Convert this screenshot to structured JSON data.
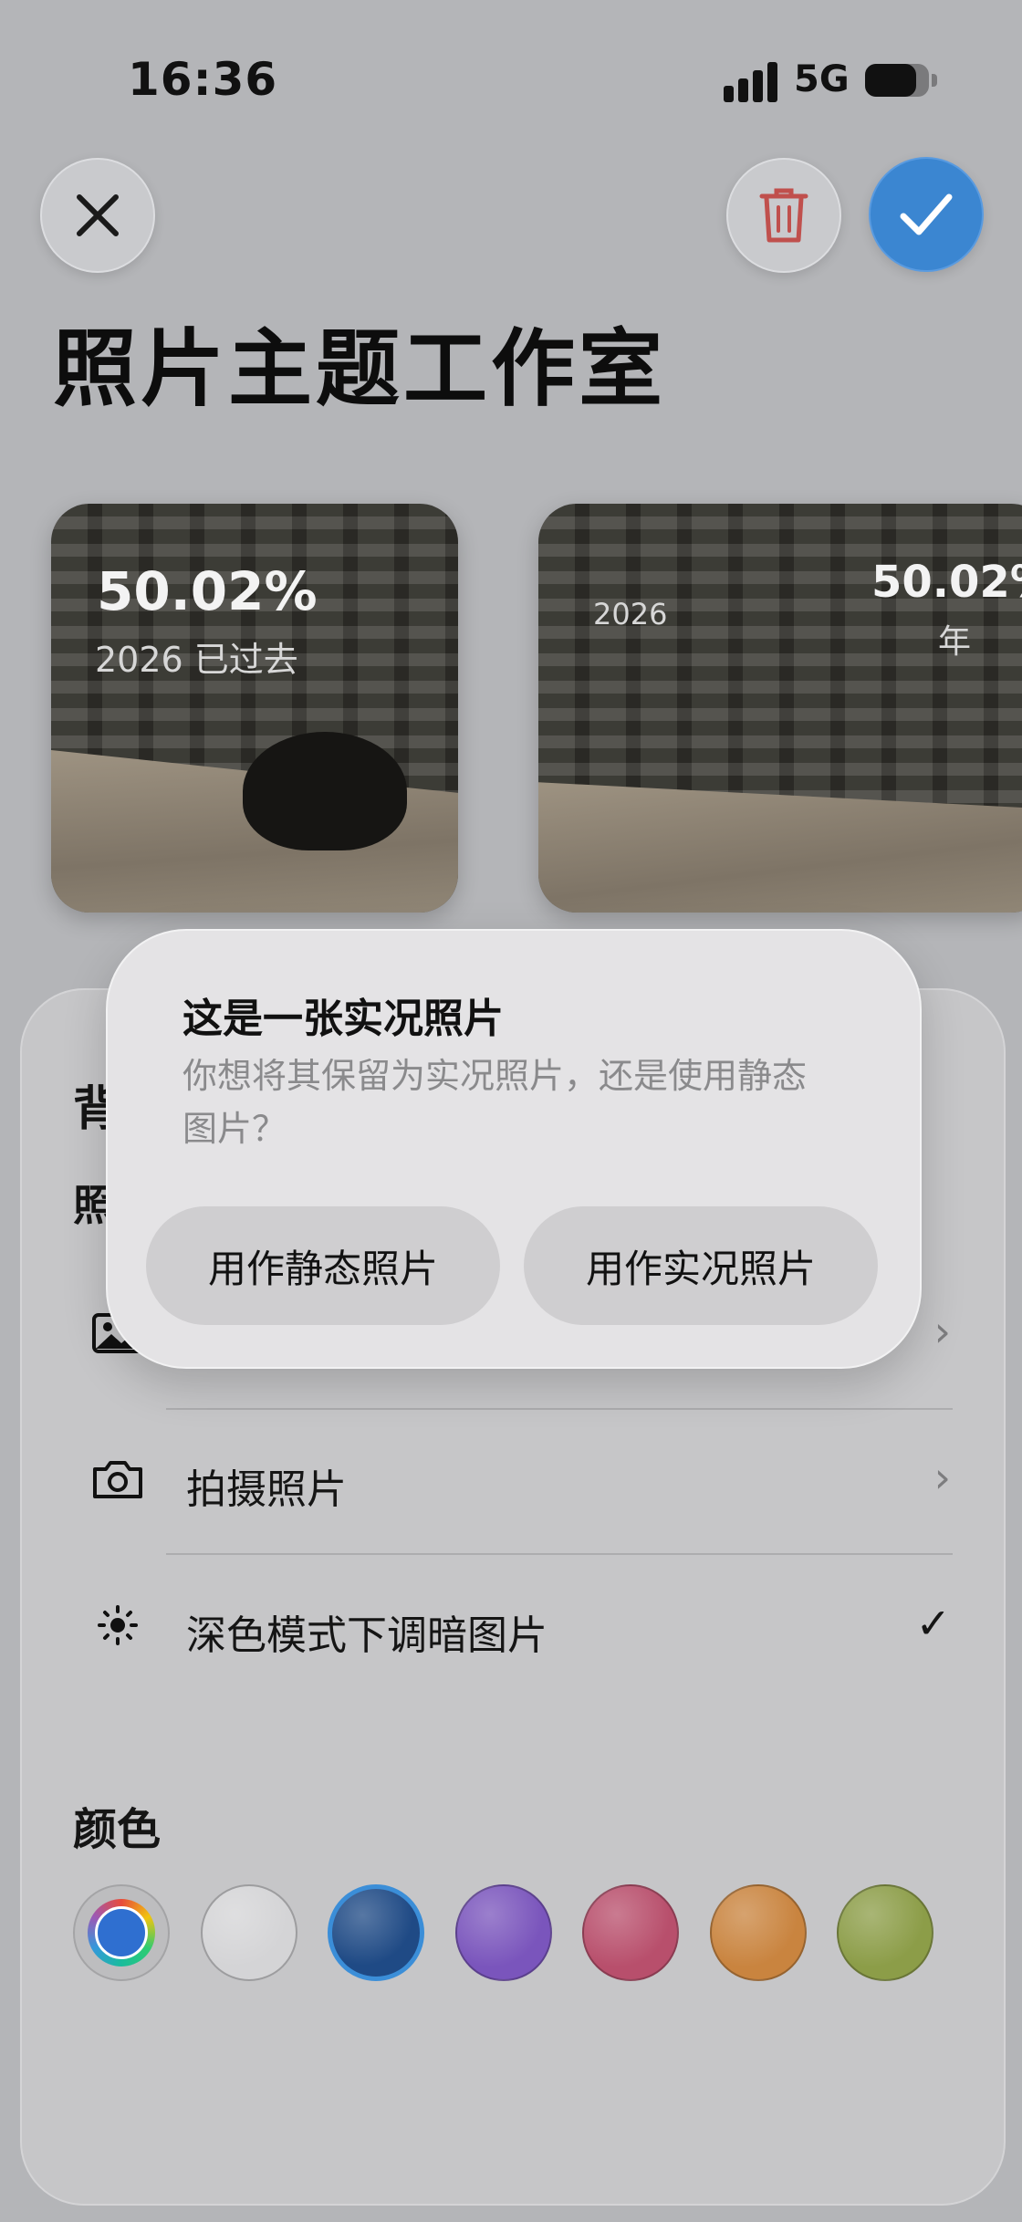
{
  "status_bar": {
    "time": "16:36",
    "network": "5G",
    "battery_level": 0.8
  },
  "header": {
    "close_icon": "xmark-icon",
    "delete_icon": "trash-icon",
    "confirm_icon": "checkmark-icon",
    "title": "照片主题工作室"
  },
  "previews": [
    {
      "percent": "50.02%",
      "subtitle": "2026 已过去"
    },
    {
      "year": "2026",
      "percent": "50.02%",
      "unit": "年"
    }
  ],
  "settings_sheet": {
    "rows": [
      {
        "icon": "photo-icon",
        "label": "",
        "trailing": "›"
      },
      {
        "icon": "camera-icon",
        "label": "拍摄照片",
        "trailing": "›"
      },
      {
        "icon": "sun-icon",
        "label": "深色模式下调暗图片",
        "trailing": "✓"
      }
    ],
    "colors_heading": "颜色",
    "swatches": [
      {
        "name": "multicolor",
        "color": "#2f6fd0",
        "selected": false
      },
      {
        "name": "white",
        "color": "#d4d4d6",
        "selected": false
      },
      {
        "name": "blue",
        "color": "#1f4a85",
        "selected": true
      },
      {
        "name": "purple",
        "color": "#7a55bc",
        "selected": false
      },
      {
        "name": "pink",
        "color": "#b84f6c",
        "selected": false
      },
      {
        "name": "orange",
        "color": "#c9843f",
        "selected": false
      },
      {
        "name": "olive",
        "color": "#8c9d48",
        "selected": false
      }
    ]
  },
  "live_photo_dialog": {
    "title": "这是一张实况照片",
    "message": "你想将其保留为实况照片，还是使用静态图片？",
    "still_button": "用作静态照片",
    "live_button": "用作实况照片"
  },
  "colors": {
    "accent": "#3b86d1",
    "delete": "#c0504d"
  }
}
